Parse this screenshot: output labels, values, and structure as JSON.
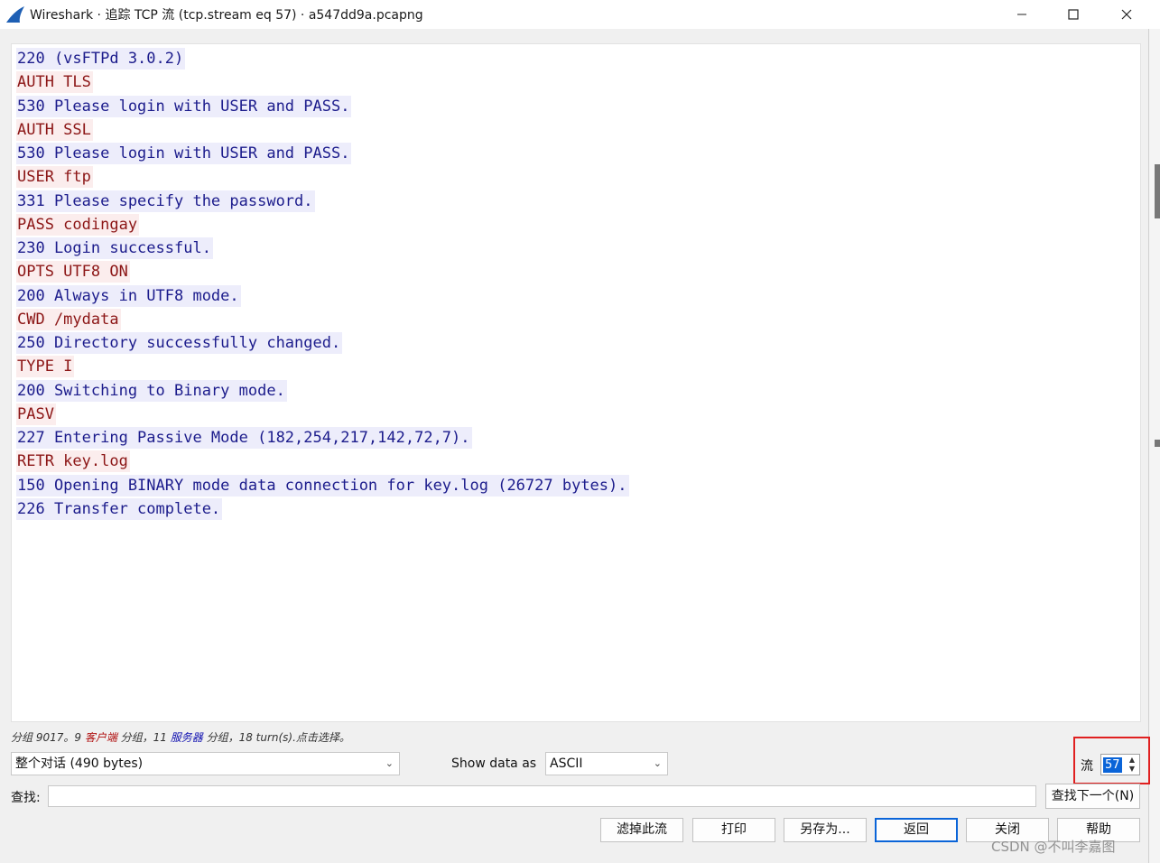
{
  "window": {
    "title": "Wireshark · 追踪 TCP 流 (tcp.stream eq 57) · a547dd9a.pcapng",
    "minimize_icon": "minimize-icon",
    "maximize_icon": "maximize-icon",
    "close_icon": "close-icon"
  },
  "stream_lines": [
    {
      "text": "220 (vsFTPd 3.0.2)",
      "side": "server"
    },
    {
      "text": "AUTH TLS",
      "side": "client"
    },
    {
      "text": "530 Please login with USER and PASS.",
      "side": "server"
    },
    {
      "text": "AUTH SSL",
      "side": "client"
    },
    {
      "text": "530 Please login with USER and PASS.",
      "side": "server"
    },
    {
      "text": "USER ftp",
      "side": "client"
    },
    {
      "text": "331 Please specify the password.",
      "side": "server"
    },
    {
      "text": "PASS codingay",
      "side": "client"
    },
    {
      "text": "230 Login successful.",
      "side": "server"
    },
    {
      "text": "OPTS UTF8 ON",
      "side": "client"
    },
    {
      "text": "200 Always in UTF8 mode.",
      "side": "server"
    },
    {
      "text": "CWD /mydata",
      "side": "client"
    },
    {
      "text": "250 Directory successfully changed.",
      "side": "server"
    },
    {
      "text": "TYPE I",
      "side": "client"
    },
    {
      "text": "200 Switching to Binary mode.",
      "side": "server"
    },
    {
      "text": "PASV",
      "side": "client"
    },
    {
      "text": "227 Entering Passive Mode (182,254,217,142,72,7).",
      "side": "server"
    },
    {
      "text": "RETR key.log",
      "side": "client"
    },
    {
      "text": "150 Opening BINARY mode data connection for key.log (26727 bytes).",
      "side": "server"
    },
    {
      "text": "226 Transfer complete.",
      "side": "server"
    }
  ],
  "colors": {
    "server_text": "#1c1c8c",
    "server_bg": "#ededfb",
    "client_text": "#8c1616",
    "client_bg": "#fbeded",
    "accent": "#0a64d8",
    "highlight_box": "#e02020"
  },
  "status": {
    "prefix": "分组 9017。9 ",
    "client_label": "客户端",
    "middle": " 分组，11 ",
    "server_label": "服务器",
    "suffix": " 分组，18 turn(s).点击选择。"
  },
  "controls": {
    "conversation_value": "整个对话  (490 bytes)",
    "show_data_label": "Show data as",
    "show_data_value": "ASCII",
    "stream_label": "流",
    "stream_number": "57",
    "find_label": "查找:",
    "find_value": "",
    "find_next": "查找下一个(N)"
  },
  "buttons": {
    "filter_out": "滤掉此流",
    "print": "打印",
    "save_as": "另存为...",
    "back": "返回",
    "close": "关闭",
    "help": "帮助"
  },
  "watermark": "CSDN @不叫李嘉图"
}
